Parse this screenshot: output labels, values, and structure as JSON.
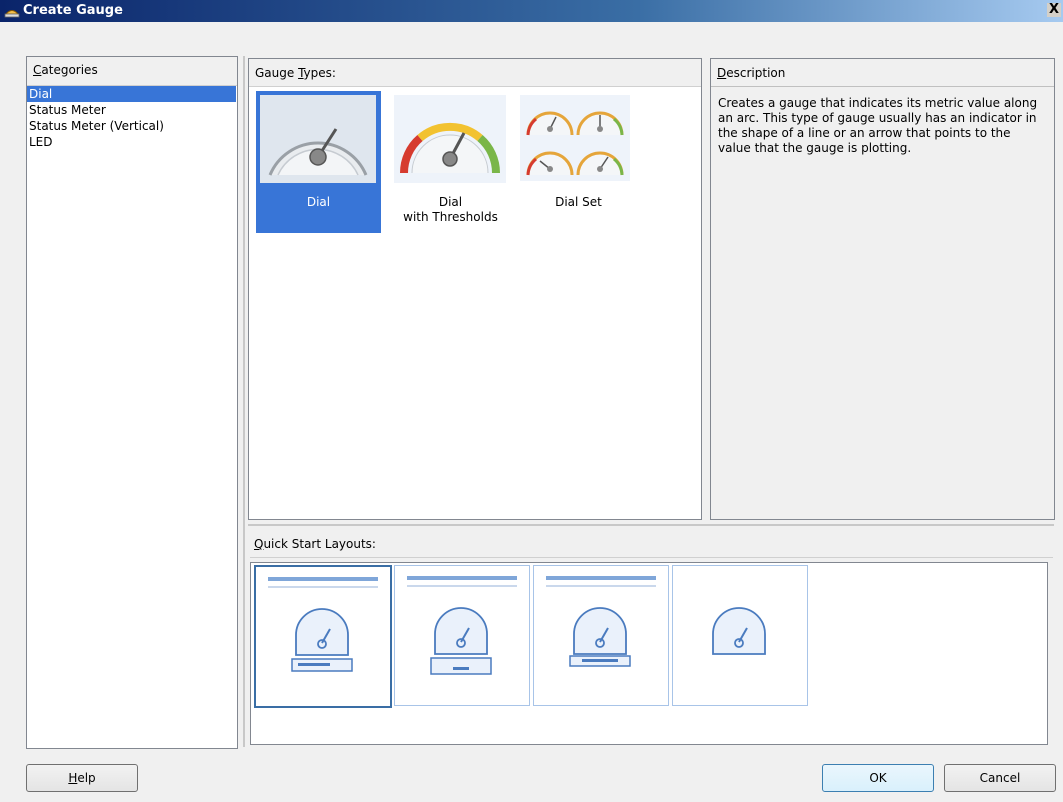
{
  "window": {
    "title": "Create Gauge",
    "close_label": "X"
  },
  "categories": {
    "header_prefix": "C",
    "header_rest": "ategories",
    "items": [
      "Dial",
      "Status Meter",
      "Status Meter (Vertical)",
      "LED"
    ],
    "selected": "Dial"
  },
  "gauge_types": {
    "header_prefix": "Gauge ",
    "header_underlined": "T",
    "header_rest": "ypes:",
    "items": [
      {
        "line1": "Dial",
        "line2": ""
      },
      {
        "line1": "Dial",
        "line2": "with Thresholds"
      },
      {
        "line1": "Dial Set",
        "line2": ""
      }
    ],
    "selected": "Dial"
  },
  "description": {
    "header_prefix": "D",
    "header_rest": "escription",
    "text": "Creates a gauge that indicates its metric value along an arc. This type of gauge usually has an indicator in the shape of a line or an arrow that points to the value that the gauge is plotting."
  },
  "quick_start": {
    "header_prefix": "Q",
    "header_rest": "uick Start Layouts:",
    "selected_index": 0
  },
  "buttons": {
    "help_prefix": "H",
    "help_rest": "elp",
    "ok": "OK",
    "cancel": "Cancel"
  },
  "colors": {
    "selection": "#3875d7",
    "title_start": "#0a246a",
    "title_end": "#a6caf0",
    "layout_icon": "#4a7bbf"
  }
}
